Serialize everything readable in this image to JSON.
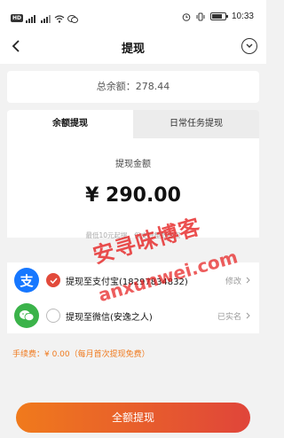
{
  "status_bar": {
    "hd": "HD",
    "signal": "4G",
    "time": "10:33",
    "battery_level": 0.8
  },
  "nav": {
    "title": "提现"
  },
  "balance": {
    "text": "总余额：278.44"
  },
  "tabs": [
    {
      "label": "余额提现",
      "active": true
    },
    {
      "label": "日常任务提现",
      "active": false
    }
  ],
  "amount": {
    "label": "提现金额",
    "value": "¥ 290.00",
    "hint": "最低10元起提，仅支持整数提现"
  },
  "methods": [
    {
      "icon": "alipay-icon",
      "icon_glyph": "支",
      "label": "提现至支付宝(18297834832)",
      "action": "修改",
      "selected": true
    },
    {
      "icon": "wechat-icon",
      "icon_glyph": "",
      "label": "提现至微信(安逸之人)",
      "action": "已实名",
      "selected": false
    }
  ],
  "fee": {
    "text": "手续费：¥ 0.00（每月首次提现免费）"
  },
  "watermark": {
    "cn": "安寻味博客",
    "en": "anxunwei.com"
  },
  "submit": {
    "label": "全额提现"
  },
  "colors": {
    "accent": "#e24a3b",
    "fee": "#f07a1e",
    "alipay": "#1677ff",
    "wechat": "#3bb34a"
  }
}
